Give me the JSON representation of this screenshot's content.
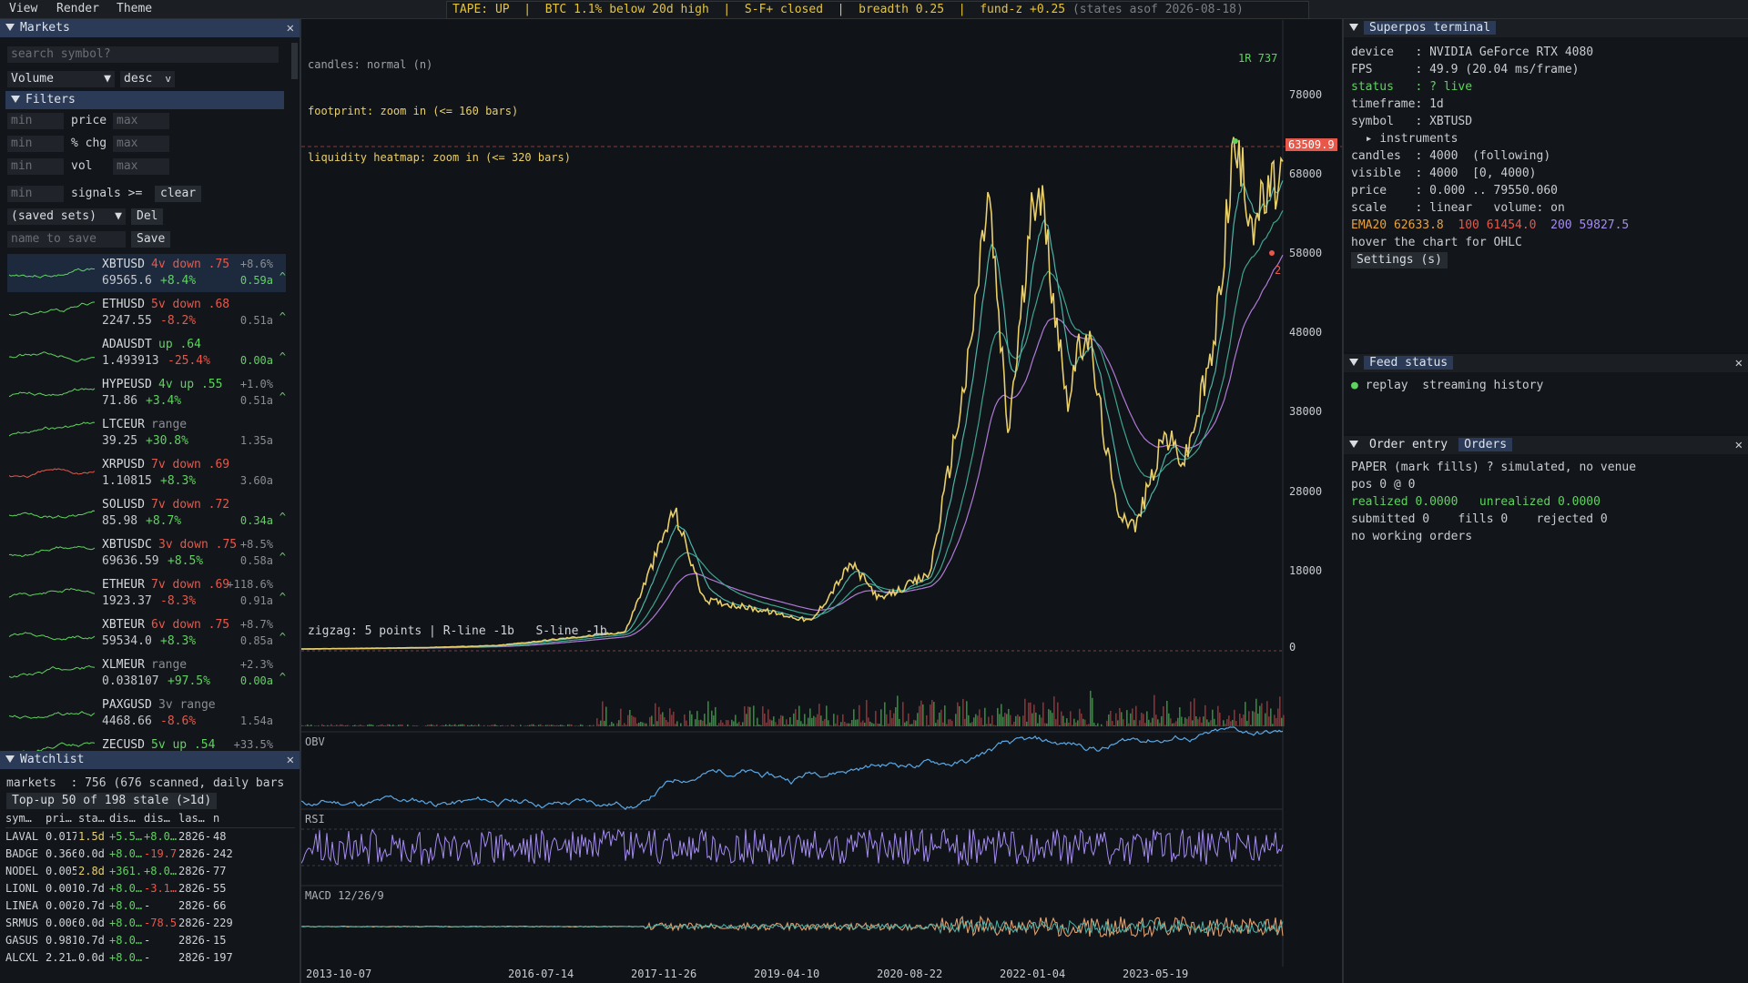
{
  "menu": [
    "View",
    "Render",
    "Theme"
  ],
  "ticker": {
    "tape": "TAPE: UP",
    "btc": "BTC 1.1% below 20d high",
    "sf": "S-F+ closed",
    "breadth": "breadth 0.25",
    "fund": "fund-z +0.25",
    "states": "(states asof 2026-08-18)"
  },
  "markets": {
    "title": "Markets",
    "search_placeholder": "search symbol?",
    "sort_field": "Volume",
    "sort_dir": "desc",
    "filters_title": "Filters",
    "filter_rows": [
      {
        "min": "min",
        "label": "price",
        "max": "max"
      },
      {
        "min": "min",
        "label": "% chg",
        "max": "max"
      },
      {
        "min": "min",
        "label": "vol",
        "max": "max"
      }
    ],
    "signals_min": "min",
    "signals_label": "signals >=",
    "clear_label": "clear",
    "saved_sets": "(saved sets)",
    "del_label": "Del",
    "save_placeholder": "name to save",
    "save_label": "Save",
    "items": [
      {
        "symbol": "XBTUSD",
        "note": "4v down .75",
        "note_type": "neg",
        "price": "69565.6",
        "change": "+8.4%",
        "change_type": "pos",
        "right1": "+8.6%",
        "right2": "0.59a",
        "right2_type": "pos",
        "caret": true,
        "spark": "#5fd35f"
      },
      {
        "symbol": "ETHUSD",
        "note": "5v down .68",
        "note_type": "neg",
        "price": "2247.55",
        "change": "-8.2%",
        "change_type": "neg",
        "right1": "",
        "right2": "0.51a",
        "right2_type": "muted",
        "caret": true,
        "spark": "#5fd35f"
      },
      {
        "symbol": "ADAUSDT",
        "note": "up .64",
        "note_type": "pos",
        "price": "1.493913",
        "change": "-25.4%",
        "change_type": "neg",
        "right1": "",
        "right2": "0.00a",
        "right2_type": "pos",
        "caret": true,
        "spark": "#5fd35f"
      },
      {
        "symbol": "HYPEUSD",
        "note": "4v up .55",
        "note_type": "pos",
        "price": "71.86",
        "change": "+3.4%",
        "change_type": "pos",
        "right1": "+1.0%",
        "right2": "0.51a",
        "right2_type": "muted",
        "caret": true,
        "spark": "#5fd35f"
      },
      {
        "symbol": "LTCEUR",
        "note": "range",
        "note_type": "muted",
        "price": "39.25",
        "change": "+30.8%",
        "change_type": "pos",
        "right1": "",
        "right2": "1.35a",
        "right2_type": "muted",
        "caret": false,
        "spark": "#5fd35f"
      },
      {
        "symbol": "XRPUSD",
        "note": "7v down .69",
        "note_type": "neg",
        "price": "1.10815",
        "change": "+8.3%",
        "change_type": "pos",
        "right1": "",
        "right2": "3.60a",
        "right2_type": "muted",
        "caret": false,
        "spark": "#e8584a"
      },
      {
        "symbol": "SOLUSD",
        "note": "7v down .72",
        "note_type": "neg",
        "price": "85.98",
        "change": "+8.7%",
        "change_type": "pos",
        "right1": "",
        "right2": "0.34a",
        "right2_type": "pos",
        "caret": true,
        "spark": "#5fd35f"
      },
      {
        "symbol": "XBTUSDC",
        "note": "3v down .75",
        "note_type": "neg",
        "price": "69636.59",
        "change": "+8.5%",
        "change_type": "pos",
        "right1": "+8.5%",
        "right2": "0.58a",
        "right2_type": "muted",
        "caret": true,
        "spark": "#5fd35f"
      },
      {
        "symbol": "ETHEUR",
        "note": "7v down .69",
        "note_type": "neg",
        "price": "1923.37",
        "change": "-8.3%",
        "change_type": "neg",
        "right1": "+118.6%",
        "right2": "0.91a",
        "right2_type": "muted",
        "caret": true,
        "spark": "#5fd35f"
      },
      {
        "symbol": "XBTEUR",
        "note": "6v down .75",
        "note_type": "neg",
        "price": "59534.0",
        "change": "+8.3%",
        "change_type": "pos",
        "right1": "+8.7%",
        "right2": "0.85a",
        "right2_type": "muted",
        "caret": true,
        "spark": "#5fd35f"
      },
      {
        "symbol": "XLMEUR",
        "note": "range",
        "note_type": "muted",
        "price": "0.038107",
        "change": "+97.5%",
        "change_type": "pos",
        "right1": "+2.3%",
        "right2": "0.00a",
        "right2_type": "pos",
        "caret": true,
        "spark": "#5fd35f"
      },
      {
        "symbol": "PAXGUSD",
        "note": "3v range",
        "note_type": "muted",
        "price": "4468.66",
        "change": "-8.6%",
        "change_type": "neg",
        "right1": "",
        "right2": "1.54a",
        "right2_type": "muted",
        "caret": false,
        "spark": "#5fd35f"
      },
      {
        "symbol": "ZECUSD",
        "note": "5v up .54",
        "note_type": "pos",
        "price": "",
        "change": "",
        "change_type": "pos",
        "right1": "+33.5%",
        "right2": "",
        "right2_type": "muted",
        "caret": false,
        "spark": "#5fd35f"
      }
    ]
  },
  "watchlist": {
    "title": "Watchlist",
    "markets_line": "markets  : 756 (676 scanned, daily bars",
    "topup_btn": "Top-up 50 of 198 stale (>1d)",
    "headers": [
      "sym…",
      "pri…",
      "sta…",
      "dis…",
      "dis…",
      "las…",
      "n"
    ],
    "rows": [
      [
        "LAVAL",
        "0.017",
        "1.5d",
        "+5.5…",
        "+8.0…",
        "2826-",
        "48"
      ],
      [
        "BADGE",
        "0.366",
        "0.0d",
        "+8.0…",
        "-19.7",
        "2826-",
        "242"
      ],
      [
        "NODEL",
        "0.005",
        "2.8d",
        "+361.",
        "+8.0…",
        "2826-",
        "77"
      ],
      [
        "LIONL",
        "0.001",
        "0.7d",
        "+8.0…",
        "-3.1…",
        "2826-",
        "55"
      ],
      [
        "LINEA",
        "0.002",
        "0.7d",
        "+8.0…",
        "-",
        "2826-",
        "66"
      ],
      [
        "SRMUS",
        "0.006",
        "0.0d",
        "+8.0…",
        "-78.5",
        "2826-",
        "229"
      ],
      [
        "GASUS",
        "0.981",
        "0.7d",
        "+8.0…",
        "-",
        "2826-",
        "15"
      ],
      [
        "ALCXL",
        "2.21…",
        "0.0d",
        "+8.0…",
        "-",
        "2826-",
        "197"
      ]
    ]
  },
  "chart": {
    "overlay_lines": [
      "candles: normal (n)",
      "footprint: zoom in (<= 160 bars)",
      "liquidity heatmap: zoom in (<= 320 bars)"
    ],
    "zigzag_line": "zigzag: 5 points | R-line -1b   S-line -1b",
    "last_price_tag": "63509.9",
    "high_tag": "1R 737",
    "low_tag": "2",
    "price_axis": [
      "78000",
      "68000",
      "58000",
      "48000",
      "38000",
      "28000",
      "18000",
      "0"
    ],
    "date_axis": [
      "2013-10-07",
      "2016-07-14",
      "2017-11-26",
      "2019-04-10",
      "2020-08-22",
      "2022-01-04",
      "2023-05-19"
    ],
    "obv_label": "OBV",
    "rsi_label": "RSI",
    "macd_label": "MACD 12/26/9"
  },
  "chart_data": {
    "type": "line",
    "ylim": [
      0,
      80000
    ],
    "x": [
      "2013-10-07",
      "2016-07-14",
      "2017-11-26",
      "2019-04-10",
      "2020-08-22",
      "2022-01-04",
      "2023-05-19"
    ],
    "series": [
      {
        "name": "",
        "values": [
          120,
          600,
          19000,
          5000,
          11500,
          47000,
          27000
        ]
      }
    ]
  },
  "terminal": {
    "title": "Superpos terminal",
    "lines": [
      {
        "k": "device   ",
        "v": ": NVIDIA GeForce RTX 4080",
        "t": ""
      },
      {
        "k": "FPS      ",
        "v": ": 49.9 (20.04 ms/frame)",
        "t": ""
      },
      {
        "k": "status   ",
        "v": ": ? live",
        "t": "green"
      },
      {
        "k": "timeframe",
        "v": ": 1d",
        "t": ""
      },
      {
        "k": "symbol   ",
        "v": ": XBTUSD",
        "t": ""
      }
    ],
    "instruments": "instruments",
    "lines2": [
      {
        "k": "candles  ",
        "v": ": 4000  (following)"
      },
      {
        "k": "visible  ",
        "v": ": 4000  [0, 4000)"
      },
      {
        "k": "price    ",
        "v": ": 0.000 .. 79550.060"
      },
      {
        "k": "scale    ",
        "v": ": linear   volume: on"
      }
    ],
    "ema20": "EMA20 62633.8",
    "ema100": "100 61454.0",
    "ema200": "200 59827.5",
    "hover": "hover the chart for OHLC",
    "settings_btn": "Settings (s)"
  },
  "feed": {
    "title": "Feed status",
    "status_text": "replay  streaming history"
  },
  "orders": {
    "tab_entry": "Order entry",
    "tab_orders": "Orders",
    "paper": "PAPER (mark fills) ? simulated, no venue",
    "pos": "pos 0 @ 0",
    "realized": "realized 0.0000",
    "unrealized": "unrealized 0.0000",
    "submitted": "submitted 0    fills 0    rejected 0",
    "no_orders": "no working orders"
  },
  "colors": {
    "accent": "#2a3a57",
    "up": "#5fd35f",
    "down": "#e8584a",
    "price_line": "#e9cf6a",
    "ema_teal": "#4fb3a6",
    "ema_purple": "#b07ad6",
    "obv": "#5aa9e6",
    "rsi": "#a58cf0"
  }
}
